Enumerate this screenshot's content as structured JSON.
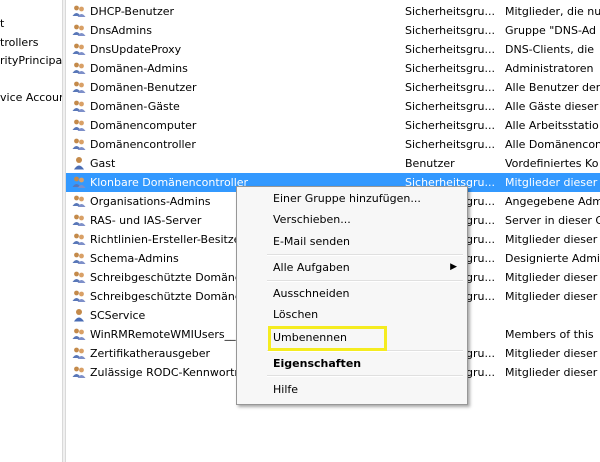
{
  "tree": {
    "items": [
      "t",
      "trollers",
      "rityPrincipal:",
      "vice Accour"
    ]
  },
  "list": {
    "rows": [
      {
        "name": "DHCP-Benutzer",
        "type": "Sicherheitsgru...",
        "desc": "Mitglieder, die nu",
        "icon": "group-icon"
      },
      {
        "name": "DnsAdmins",
        "type": "Sicherheitsgru...",
        "desc": "Gruppe \"DNS-Ad",
        "icon": "group-icon"
      },
      {
        "name": "DnsUpdateProxy",
        "type": "Sicherheitsgru...",
        "desc": "DNS-Clients, die",
        "icon": "group-icon"
      },
      {
        "name": "Domänen-Admins",
        "type": "Sicherheitsgru...",
        "desc": "Administratoren",
        "icon": "group-icon"
      },
      {
        "name": "Domänen-Benutzer",
        "type": "Sicherheitsgru...",
        "desc": "Alle Benutzer der",
        "icon": "group-icon"
      },
      {
        "name": "Domänen-Gäste",
        "type": "Sicherheitsgru...",
        "desc": "Alle Gäste dieser",
        "icon": "group-icon"
      },
      {
        "name": "Domänencomputer",
        "type": "Sicherheitsgru...",
        "desc": "Alle Arbeitsstatio",
        "icon": "group-icon"
      },
      {
        "name": "Domänencontroller",
        "type": "Sicherheitsgru...",
        "desc": "Alle Domänencon",
        "icon": "group-icon"
      },
      {
        "name": "Gast",
        "type": "Benutzer",
        "desc": "Vordefiniertes Ko",
        "icon": "user-icon"
      },
      {
        "name": "Klonbare Domänencontroller",
        "type": "Sicherheitsgru...",
        "desc": "Mitglieder dieser",
        "icon": "group-icon"
      },
      {
        "name": "Organisations-Admins",
        "type": "Sicherheitsgru...",
        "desc": "Angegebene Adm",
        "icon": "group-icon"
      },
      {
        "name": "RAS- und IAS-Server",
        "type": "Sicherheitsgru...",
        "desc": "Server in dieser G",
        "icon": "group-icon"
      },
      {
        "name": "Richtlinien-Ersteller-Besitzer",
        "type": "Sicherheitsgru...",
        "desc": "Mitglieder dieser",
        "icon": "group-icon"
      },
      {
        "name": "Schema-Admins",
        "type": "Sicherheitsgru...",
        "desc": "Designierte Admi",
        "icon": "group-icon"
      },
      {
        "name": "Schreibgeschützte Domänen",
        "type": "Sicherheitsgru...",
        "desc": "Mitglieder dieser",
        "icon": "group-icon"
      },
      {
        "name": "Schreibgeschützte Domänen",
        "type": "Sicherheitsgru...",
        "desc": "Mitglieder dieser",
        "icon": "group-icon"
      },
      {
        "name": "SCService",
        "type": "",
        "desc": "",
        "icon": "user-icon"
      },
      {
        "name": "WinRMRemoteWMIUsers__",
        "type": "",
        "desc": "Members of this",
        "icon": "group-icon"
      },
      {
        "name": "Zertifikatherausgeber",
        "type": "Sicherheitsgru...",
        "desc": "Mitglieder dieser",
        "icon": "group-icon"
      },
      {
        "name": "Zulässige RODC-Kennwortre",
        "type": "Sicherheitsgru...",
        "desc": "Mitglieder dieser",
        "icon": "group-icon"
      }
    ],
    "selected_index": 9
  },
  "context_menu": {
    "add_to_group": "Einer Gruppe hinzufügen...",
    "move": "Verschieben...",
    "send_email": "E-Mail senden",
    "all_tasks": "Alle Aufgaben",
    "cut": "Ausschneiden",
    "delete": "Löschen",
    "rename": "Umbenennen",
    "properties": "Eigenschaften",
    "help": "Hilfe"
  },
  "colors": {
    "selection": "#3399ff",
    "highlight_box": "#f5ec20",
    "menu_bg": "#f7f7f7"
  }
}
